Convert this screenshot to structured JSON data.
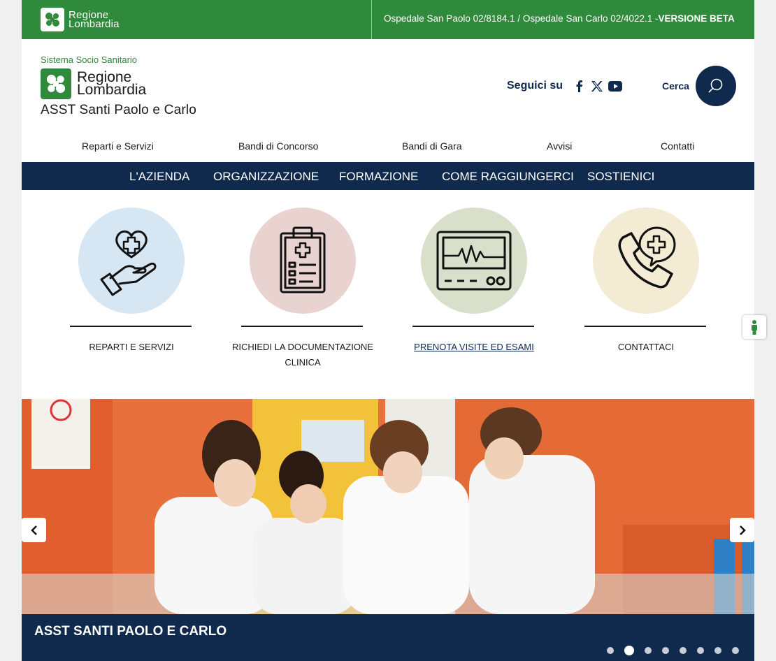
{
  "topbar": {
    "logo_line1": "Regione",
    "logo_line2": "Lombardia",
    "phones": "Ospedale San Paolo 02/8184.1 / Ospedale San Carlo 02/4022.1 -",
    "beta": "VERSIONE BETA"
  },
  "header": {
    "system": "Sistema Socio Sanitario",
    "logo_line1": "Regione",
    "logo_line2": "Lombardia",
    "asst": "ASST Santi Paolo e Carlo",
    "follow": "Seguici su",
    "search_label": "Cerca",
    "social": [
      "facebook-icon",
      "x-icon",
      "youtube-icon"
    ]
  },
  "sublinks": [
    "Reparti e Servizi",
    "Bandi di Concorso",
    "Bandi di Gara",
    "Avvisi",
    "Contatti"
  ],
  "mainnav": [
    "L'AZIENDA",
    "ORGANIZZAZIONE",
    "FORMAZIONE",
    "COME RAGGIUNGERCI",
    "SOSTIENICI"
  ],
  "cards": [
    {
      "label": "REPARTI E SERVIZI",
      "icon": "heart-hand-icon",
      "color": "#d6e6f2"
    },
    {
      "label": "RICHIEDI LA DOCUMENTAZIONE CLINICA",
      "icon": "clipboard-medical-icon",
      "color": "#e8d3d1"
    },
    {
      "label": "PRENOTA VISITE ED ESAMI",
      "icon": "monitor-heartbeat-icon",
      "color": "#d8e0cc"
    },
    {
      "label": "CONTATTACI",
      "icon": "phone-medical-icon",
      "color": "#f3ebd4"
    }
  ],
  "hero": {
    "caption": "ASST SANTI PAOLO E CARLO",
    "slides_total": 8,
    "active_slide": 2
  },
  "colors": {
    "green": "#2f8a3b",
    "navy": "#0f2a4d"
  }
}
